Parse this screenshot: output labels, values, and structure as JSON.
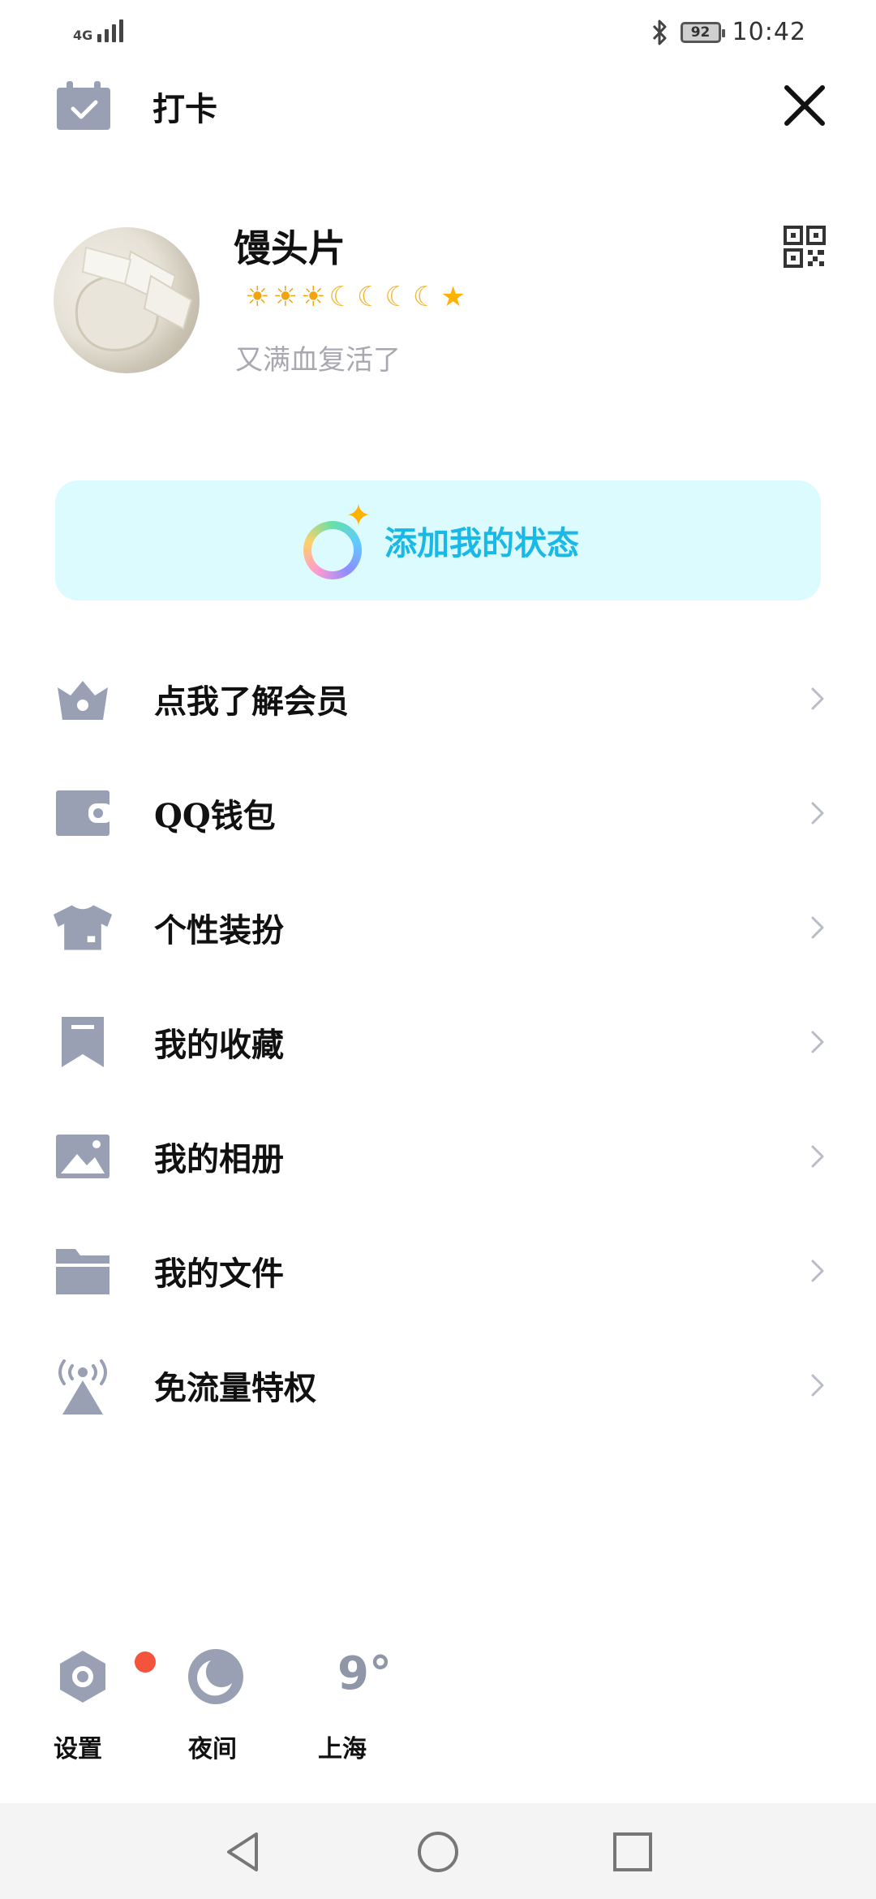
{
  "status_bar": {
    "network": "4G",
    "battery": "92",
    "time": "10:42"
  },
  "header": {
    "checkin_label": "打卡"
  },
  "profile": {
    "nickname": "馒头片",
    "level_icons": {
      "sun": "☀",
      "moon": "☾",
      "star": "★"
    },
    "signature": "又满血复活了"
  },
  "status_banner": {
    "label": "添加我的状态"
  },
  "menu": {
    "items": [
      {
        "label": "点我了解会员",
        "icon": "crown-icon"
      },
      {
        "label": "QQ钱包",
        "icon": "wallet-icon"
      },
      {
        "label": "个性装扮",
        "icon": "shirt-icon"
      },
      {
        "label": "我的收藏",
        "icon": "bookmark-icon"
      },
      {
        "label": "我的相册",
        "icon": "image-icon"
      },
      {
        "label": "我的文件",
        "icon": "folder-icon"
      },
      {
        "label": "免流量特权",
        "icon": "antenna-icon"
      }
    ]
  },
  "bottom_tools": {
    "settings_label": "设置",
    "night_label": "夜间",
    "weather_temp": "9°",
    "weather_city": "上海"
  },
  "colors": {
    "icon_gray": "#9aa0b4",
    "banner_bg": "#dcfbff",
    "banner_text": "#18b9e6",
    "badge_red": "#f4533c"
  }
}
